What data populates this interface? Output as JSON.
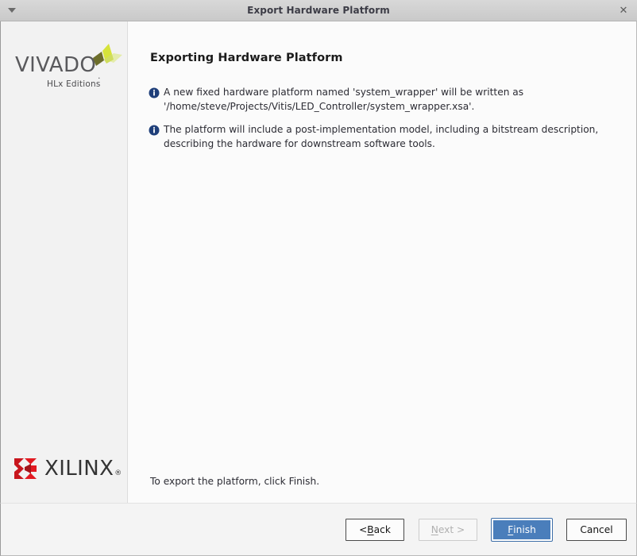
{
  "window": {
    "title": "Export Hardware Platform",
    "menu_icon": "window-menu-triangle-icon",
    "close_icon": "close-icon",
    "close_glyph": "✕"
  },
  "sidebar": {
    "vivado_logo": {
      "wordmark": "VIVADO",
      "trademark_dot": ".",
      "subtitle": "HLx Editions",
      "mark_icon": "vivado-butterfly-mark-icon",
      "mark_colors": [
        "#6d6e2b",
        "#d6e33a",
        "#e4ecaa"
      ]
    },
    "xilinx_logo": {
      "wordmark": "XILINX",
      "registered": "®",
      "mark_icon": "xilinx-x-mark-icon",
      "mark_colors": [
        "#e21a22",
        "#a3141a",
        "#c8161d"
      ]
    }
  },
  "main": {
    "heading": "Exporting Hardware Platform",
    "messages": [
      {
        "icon": "info-icon",
        "text": "A new fixed hardware platform named 'system_wrapper' will be written as\n'/home/steve/Projects/Vitis/LED_Controller/system_wrapper.xsa'."
      },
      {
        "icon": "info-icon",
        "text": "The platform will include a post-implementation model, including a bitstream description,\ndescribing the hardware for downstream software tools."
      }
    ],
    "hint": "To export the platform, click Finish."
  },
  "buttons": {
    "back": {
      "prefix": "< ",
      "mnemonic": "B",
      "suffix": "ack",
      "enabled": true
    },
    "next": {
      "prefix": "",
      "mnemonic": "N",
      "suffix": "ext >",
      "enabled": false
    },
    "finish": {
      "prefix": "",
      "mnemonic": "F",
      "suffix": "inish",
      "enabled": true,
      "primary": true
    },
    "cancel": {
      "label": "Cancel",
      "enabled": true
    }
  },
  "colors": {
    "titlebar": "#d0d0d0",
    "sidebar_bg": "#f2f2f2",
    "content_bg": "#fbfbfb",
    "footer_bg": "#f4f4f4",
    "primary_button": "#4a7ebb",
    "info_icon": "#1f3f7a",
    "xilinx_red": "#e21a22",
    "vivado_grey": "#59595c"
  }
}
